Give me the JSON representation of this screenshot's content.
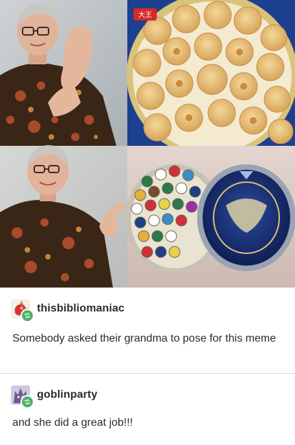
{
  "meme": {
    "panels": [
      {
        "subject": "grandma-rejecting-gesture"
      },
      {
        "subject": "butter-cookie-tin-open"
      },
      {
        "subject": "grandma-pointing-gesture"
      },
      {
        "subject": "cookie-tin-with-sewing-thread"
      }
    ],
    "tin_logo_text": "大王"
  },
  "posts": [
    {
      "username": "thisbibliomaniac",
      "text": "Somebody asked their grandma to pose for this meme",
      "avatar_icon": "red-bird-avatar",
      "badge_icon": "reblog-icon"
    },
    {
      "username": "goblinparty",
      "text": "and she did a great job!!!",
      "avatar_icon": "purple-creature-avatar",
      "badge_icon": "reblog-icon"
    }
  ],
  "colors": {
    "reblog_green": "#4fb06c",
    "divider": "#d9d9d9",
    "text": "#2a2a2a"
  }
}
